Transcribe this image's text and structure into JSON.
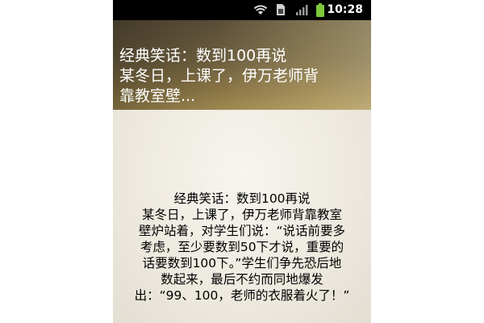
{
  "status_bar": {
    "time": "10:28",
    "icons": [
      "wifi-icon",
      "sim-icon",
      "signal-icon",
      "battery-icon"
    ],
    "battery_color": "#7ec83a"
  },
  "header": {
    "title": "经典笑话：数到100再说",
    "preview_lines": [
      "某冬日，上课了，伊万老师背",
      "靠教室壁..."
    ]
  },
  "article": {
    "lines": [
      "经典笑话：数到100再说",
      "某冬日，上课了，伊万老师背靠教室",
      "壁炉站着，对学生们说：“说话前要多",
      "考虑，至少要数到50下才说，重要的",
      "话要数到100下。”学生们争先恐后地",
      "数起来，最后不约而同地爆发",
      "出：“99、100，老师的衣服着火了！”"
    ]
  }
}
